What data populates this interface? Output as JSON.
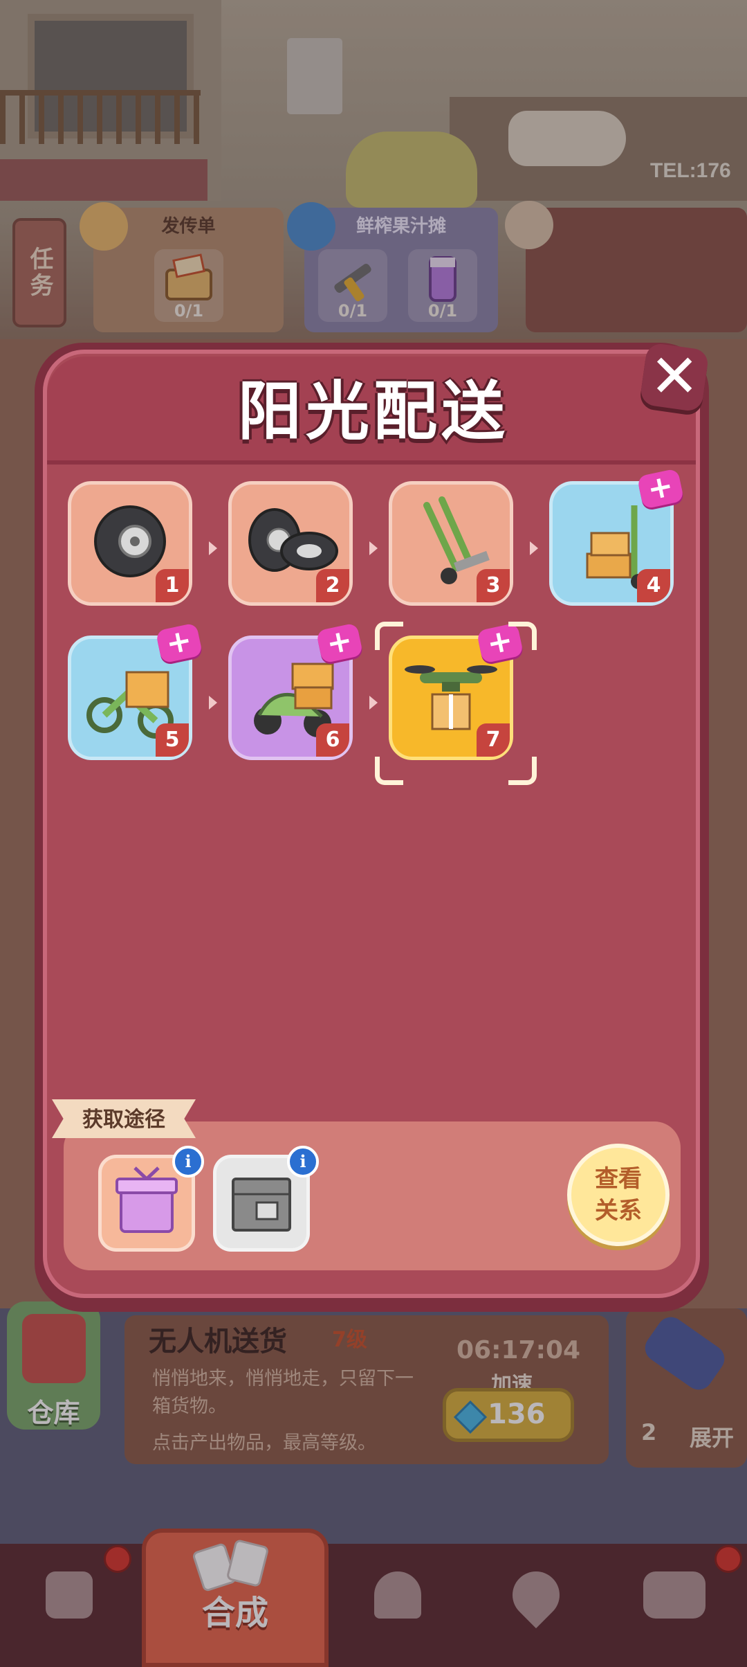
{
  "background": {
    "tel_sign": "TEL:176"
  },
  "tasks": {
    "tab_label": "任务",
    "cards": [
      {
        "title": "发传单",
        "items": [
          {
            "count": "0/1"
          }
        ]
      },
      {
        "title": "鲜榨果汁摊",
        "items": [
          {
            "count": "0/1"
          },
          {
            "count": "0/1"
          }
        ]
      }
    ]
  },
  "modal": {
    "title": "阳光配送",
    "close_symbol": "✕",
    "chain": [
      {
        "level": "1",
        "icon": "tire-icon",
        "bg": "peach",
        "plus": false
      },
      {
        "level": "2",
        "icon": "double-tire-icon",
        "bg": "peach",
        "plus": false
      },
      {
        "level": "3",
        "icon": "hand-truck-icon",
        "bg": "peach",
        "plus": false
      },
      {
        "level": "4",
        "icon": "hand-truck-boxes-icon",
        "bg": "blue",
        "plus": true
      },
      {
        "level": "5",
        "icon": "bike-box-icon",
        "bg": "blue",
        "plus": true
      },
      {
        "level": "6",
        "icon": "scooter-boxes-icon",
        "bg": "purple",
        "plus": true
      },
      {
        "level": "7",
        "icon": "drone-box-icon",
        "bg": "gold",
        "plus": true,
        "selected": true
      }
    ],
    "plus_symbol": "+",
    "source": {
      "label": "获取途径",
      "items": [
        {
          "icon": "purple-gift-box-icon",
          "info": "i"
        },
        {
          "icon": "metal-crate-icon",
          "info": "i"
        }
      ],
      "view_button": "查看\n关系"
    }
  },
  "info_panel": {
    "name": "无人机送货",
    "level": "7级",
    "description": "悄悄地来，悄悄地走，只留下一箱货物。",
    "hint": "点击产出物品，最高等级。",
    "timer": "06:17:04",
    "speed_label": "加速",
    "speed_cost": "136"
  },
  "storage": {
    "label": "仓库"
  },
  "expand": {
    "count": "2",
    "label": "展开"
  },
  "nav": {
    "active_label": "合成",
    "items": [
      {
        "icon": "cat-bag-icon"
      },
      {
        "icon": "merge-cards-icon"
      },
      {
        "icon": "service-bell-icon"
      },
      {
        "icon": "map-pin-cat-icon"
      },
      {
        "icon": "bus-icon"
      }
    ]
  },
  "colors": {
    "modal_bg": "#a94a58",
    "gold_item": "#f7b82a",
    "level_badge": "#c6443e",
    "plus_badge": "#e844b8"
  }
}
